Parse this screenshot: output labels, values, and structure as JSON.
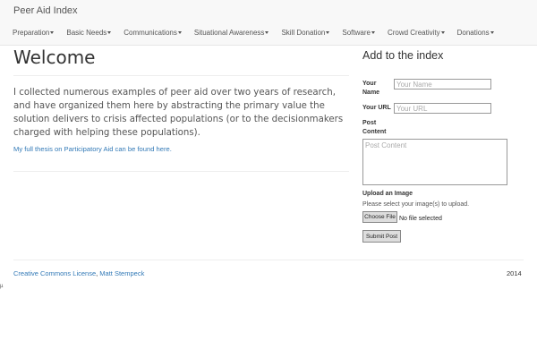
{
  "navbar": {
    "brand": "Peer Aid Index",
    "menu": [
      {
        "label": "Preparation"
      },
      {
        "label": "Basic Needs"
      },
      {
        "label": "Communications"
      },
      {
        "label": "Situational Awareness"
      },
      {
        "label": "Skill Donation"
      },
      {
        "label": "Software"
      },
      {
        "label": "Crowd Creativity"
      },
      {
        "label": "Donations"
      }
    ]
  },
  "main": {
    "title": "Welcome",
    "intro": "I collected numerous examples of peer aid over two years of research, and have organized them here by abstracting the primary value the solution delivers to crisis affected populations (or to the decisionmakers charged with helping these populations).",
    "thesis_link": "My full thesis on Participatory Aid can be found here."
  },
  "sidebar": {
    "title": "Add to the index",
    "name_label": "Your Name",
    "name_placeholder": "Your Name",
    "url_label": "Your URL",
    "url_placeholder": "Your URL",
    "content_label": "Post Content",
    "content_placeholder": "Post Content",
    "upload_label": "Upload an Image",
    "upload_help": "Please select your image(s) to upload.",
    "choose_file": "Choose File",
    "no_file": "No file selected",
    "submit": "Submit Post"
  },
  "footer": {
    "license": "Creative Commons License",
    "separator": ", ",
    "author": "Matt Stempeck",
    "year": "2014",
    "stray": "µ"
  }
}
